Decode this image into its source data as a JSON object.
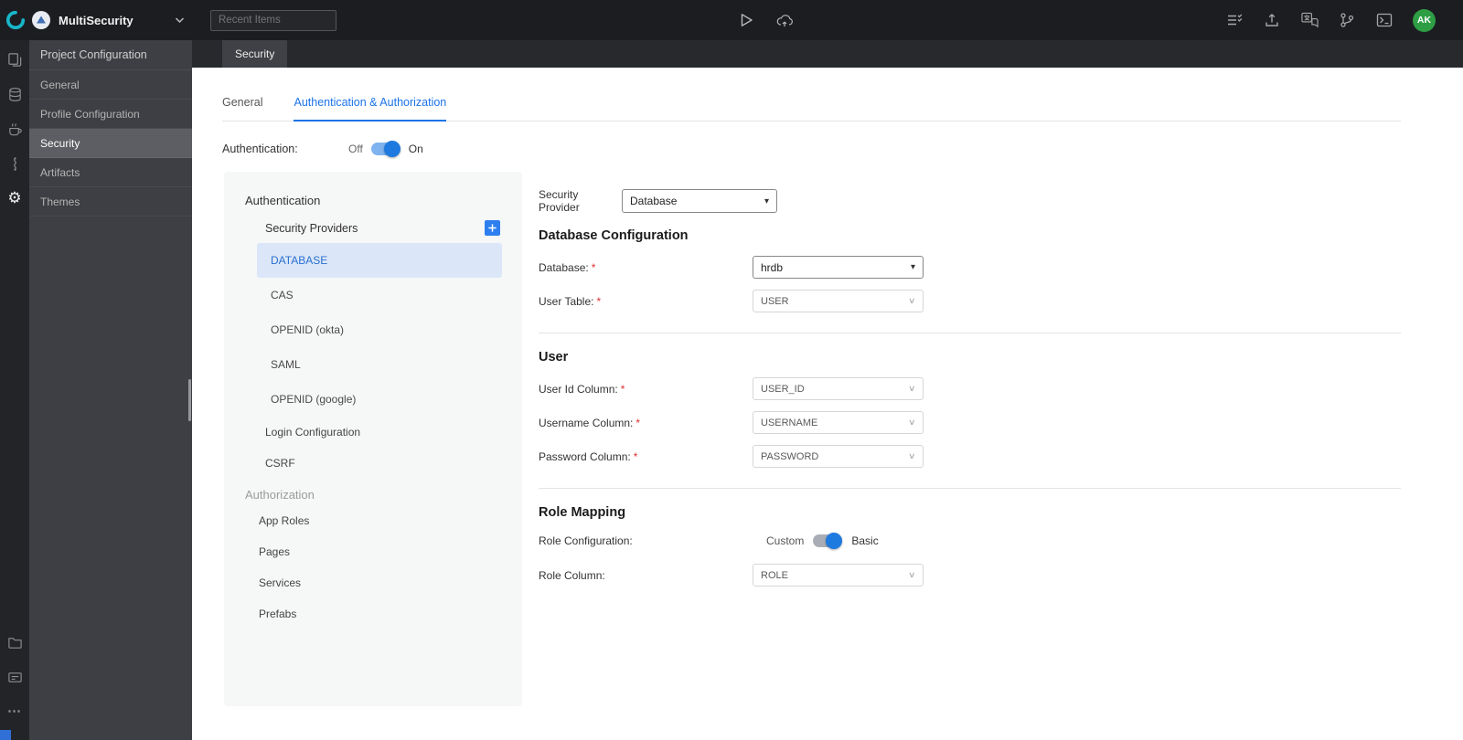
{
  "accent_color": "#1a73e8",
  "icons": {
    "select_chevron": "▾",
    "select_chevron_light": "∨",
    "gear": "⚙",
    "ellipsis": "⋯"
  },
  "topbar": {
    "project_name": "MultiSecurity",
    "recent_items_placeholder": "Recent Items",
    "avatar_initials": "AK"
  },
  "sidebar": {
    "title": "Project Configuration",
    "items": [
      {
        "label": "General"
      },
      {
        "label": "Profile Configuration"
      },
      {
        "label": "Security",
        "active": true
      },
      {
        "label": "Artifacts"
      },
      {
        "label": "Themes"
      }
    ]
  },
  "editor": {
    "tab": "Security"
  },
  "tabs": {
    "general": "General",
    "auth": "Authentication & Authorization"
  },
  "auth_row": {
    "label": "Authentication:",
    "off": "Off",
    "on": "On",
    "state": "on"
  },
  "nav": {
    "auth_header": "Authentication",
    "providers_label": "Security Providers",
    "providers": [
      "DATABASE",
      "CAS",
      "OPENID (okta)",
      "SAML",
      "OPENID (google)"
    ],
    "selected_provider": "DATABASE",
    "login_configuration": "Login Configuration",
    "csrf": "CSRF",
    "authorization_header": "Authorization",
    "authorization_items": [
      "App Roles",
      "Pages",
      "Services",
      "Prefabs"
    ]
  },
  "form": {
    "required_marker": "*",
    "security_provider_label": "Security Provider",
    "security_provider_value": "Database",
    "database_configuration_heading": "Database Configuration",
    "database_label": "Database:",
    "database_value": "hrdb",
    "user_table_label": "User Table:",
    "user_table_value": "USER",
    "user_heading": "User",
    "user_id_label": "User Id Column:",
    "user_id_value": "USER_ID",
    "username_label": "Username Column:",
    "username_value": "USERNAME",
    "password_label": "Password Column:",
    "password_value": "PASSWORD",
    "role_mapping_heading": "Role Mapping",
    "role_configuration_label": "Role Configuration:",
    "role_custom": "Custom",
    "role_basic": "Basic",
    "role_column_label": "Role Column:",
    "role_column_value": "ROLE"
  }
}
